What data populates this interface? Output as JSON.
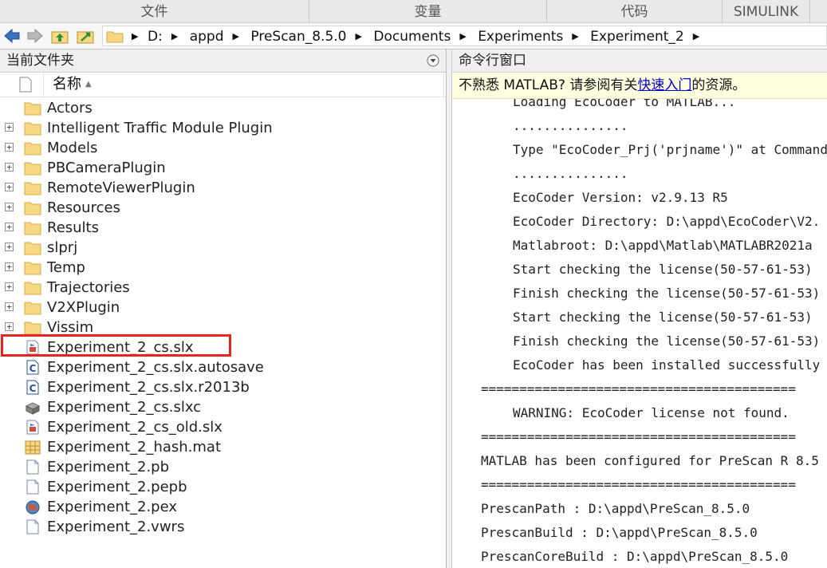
{
  "toolstrip": {
    "tabs": [
      "文件",
      "变量",
      "代码",
      "SIMULINK"
    ]
  },
  "address": {
    "crumbs": [
      "D:",
      "appd",
      "PreScan_8.5.0",
      "Documents",
      "Experiments",
      "Experiment_2"
    ]
  },
  "file_browser": {
    "title": "当前文件夹",
    "column_name": "名称",
    "items": [
      {
        "name": "Actors",
        "type": "folder",
        "expandable": false
      },
      {
        "name": "Intelligent Traffic Module Plugin",
        "type": "folder",
        "expandable": true
      },
      {
        "name": "Models",
        "type": "folder",
        "expandable": true
      },
      {
        "name": "PBCameraPlugin",
        "type": "folder",
        "expandable": true
      },
      {
        "name": "RemoteViewerPlugin",
        "type": "folder",
        "expandable": true
      },
      {
        "name": "Resources",
        "type": "folder",
        "expandable": true
      },
      {
        "name": "Results",
        "type": "folder",
        "expandable": true
      },
      {
        "name": "slprj",
        "type": "folder",
        "expandable": true
      },
      {
        "name": "Temp",
        "type": "folder",
        "expandable": true
      },
      {
        "name": "Trajectories",
        "type": "folder",
        "expandable": true
      },
      {
        "name": "V2XPlugin",
        "type": "folder",
        "expandable": true
      },
      {
        "name": "Vissim",
        "type": "folder",
        "expandable": true
      },
      {
        "name": "Experiment_2_cs.slx",
        "type": "slx",
        "expandable": false
      },
      {
        "name": "Experiment_2_cs.slx.autosave",
        "type": "autosave",
        "expandable": false
      },
      {
        "name": "Experiment_2_cs.slx.r2013b",
        "type": "autosave",
        "expandable": false
      },
      {
        "name": "Experiment_2_cs.slxc",
        "type": "slxc",
        "expandable": false
      },
      {
        "name": "Experiment_2_cs_old.slx",
        "type": "slx",
        "expandable": false
      },
      {
        "name": "Experiment_2_hash.mat",
        "type": "mat",
        "expandable": false
      },
      {
        "name": "Experiment_2.pb",
        "type": "file",
        "expandable": false
      },
      {
        "name": "Experiment_2.pepb",
        "type": "file",
        "expandable": false
      },
      {
        "name": "Experiment_2.pex",
        "type": "pex",
        "expandable": false
      },
      {
        "name": "Experiment_2.vwrs",
        "type": "file",
        "expandable": false
      }
    ]
  },
  "command_window": {
    "title": "命令行窗口",
    "notice_prefix": "不熟悉 MATLAB? 请参阅有关",
    "notice_link": "快速入门",
    "notice_suffix": "的资源。",
    "lines": [
      {
        "text": "Loading EcoCoder to MATLAB...",
        "indent": true
      },
      {
        "text": "...............",
        "indent": true
      },
      {
        "text": "Type \"EcoCoder_Prj('prjname')\" at Command",
        "indent": true
      },
      {
        "text": "...............",
        "indent": true
      },
      {
        "text": "EcoCoder Version: v2.9.13 R5",
        "indent": true
      },
      {
        "text": "EcoCoder Directory: D:\\appd\\EcoCoder\\V2.",
        "indent": true
      },
      {
        "text": "Matlabroot: D:\\appd\\Matlab\\MATLABR2021a",
        "indent": true
      },
      {
        "text": "Start checking the license(50-57-61-53)",
        "indent": true
      },
      {
        "text": "Finish checking the license(50-57-61-53)",
        "indent": true
      },
      {
        "text": "Start checking the license(50-57-61-53)",
        "indent": true
      },
      {
        "text": "Finish checking the license(50-57-61-53)",
        "indent": true
      },
      {
        "text": "EcoCoder has been installed successfully",
        "indent": true
      },
      {
        "text": "=========================================",
        "indent": false
      },
      {
        "text": "WARNING: EcoCoder license not found.",
        "indent": true
      },
      {
        "text": "=========================================",
        "indent": false
      },
      {
        "text": "MATLAB has been configured for PreScan R 8.5",
        "indent": false
      },
      {
        "text": "=========================================",
        "indent": false
      },
      {
        "text": "PrescanPath : D:\\appd\\PreScan_8.5.0",
        "indent": false
      },
      {
        "text": "PrescanBuild : D:\\appd\\PreScan_8.5.0",
        "indent": false
      },
      {
        "text": "PrescanCoreBuild : D:\\appd\\PreScan_8.5.0",
        "indent": false
      }
    ]
  },
  "colors": {
    "highlight_border": "#e5261f",
    "notice_bg": "#ffffe1",
    "link": "#0000cc",
    "folder": "#f6d784"
  }
}
